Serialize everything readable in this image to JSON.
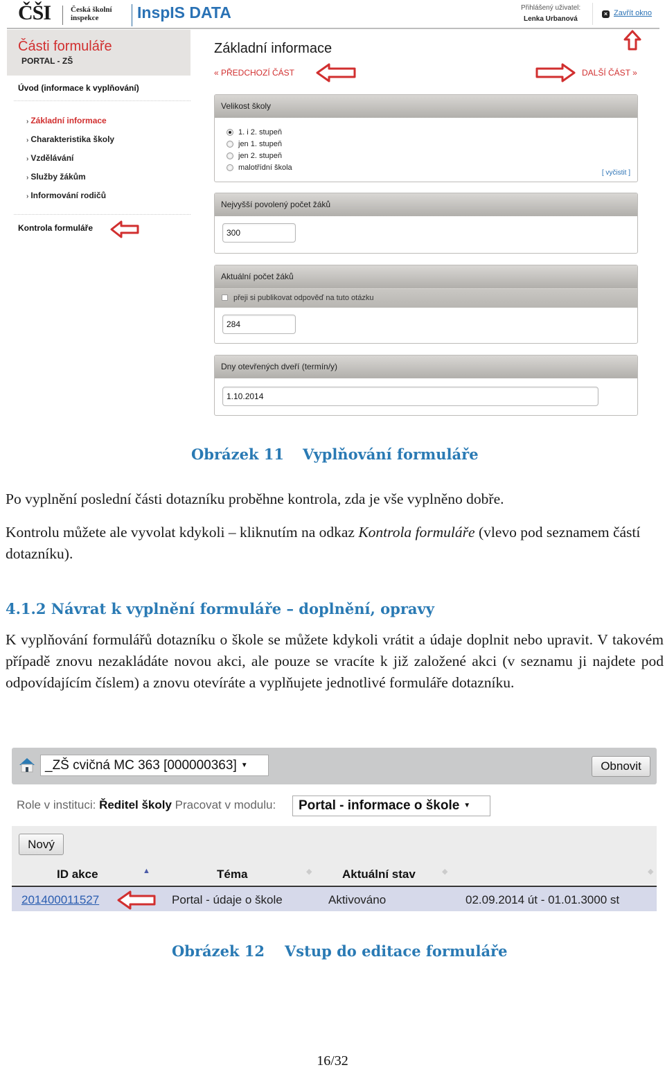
{
  "figure1": {
    "logo": {
      "brand": "ČŠI",
      "org_line1": "Česká školní",
      "org_line2": "inspekce",
      "app": "InspIS DATA"
    },
    "user": {
      "label": "Přihlášený uživatel:",
      "name": "Lenka Urbanová",
      "close_label": "Zavřít okno"
    },
    "sidebar": {
      "title": "Části formuláře",
      "subtitle": "PORTAL - ZŠ",
      "intro": "Úvod (informace k vyplňování)",
      "items": [
        {
          "label": "Základní informace",
          "active": true
        },
        {
          "label": "Charakteristika školy",
          "active": false
        },
        {
          "label": "Vzdělávání",
          "active": false
        },
        {
          "label": "Služby žákům",
          "active": false
        },
        {
          "label": "Informování rodičů",
          "active": false
        }
      ],
      "check_link": "Kontrola formuláře",
      "chevron": "›"
    },
    "main": {
      "title": "Základní informace",
      "prev": "« PŘEDCHOZÍ ČÁST",
      "next": "DALŠÍ ČÁST »",
      "panels": {
        "size": {
          "title": "Velikost školy",
          "options": [
            "1. i 2. stupeň",
            "jen 1. stupeň",
            "jen 2. stupeň",
            "malotřídní škola"
          ],
          "selected": "1. i 2. stupeň",
          "clear": "[ vyčistit ]"
        },
        "max_students": {
          "title": "Nejvyšší povolený počet žáků",
          "value": "300"
        },
        "current_students": {
          "title": "Aktuální počet žáků",
          "publish_label": "přeji si publikovat odpověď na tuto otázku",
          "publish_checked": false,
          "value": "284"
        },
        "open_days": {
          "title": "Dny otevřených dveří (termín/y)",
          "value": "1.10.2014"
        }
      }
    },
    "caption_num": "Obrázek 11",
    "caption_text": "Vyplňování formuláře"
  },
  "text": {
    "p1": "Po vyplnění poslední části dotazníku proběhne kontrola, zda je vše vyplněno dobře.",
    "p2_before": "Kontrolu můžete ale vyvolat kdykoli – kliknutím na odkaz ",
    "p2_italic": "Kontrola formuláře",
    "p2_after": " (vlevo pod seznamem částí dotazníku).",
    "section_heading": "4.1.2  Návrat k vyplnění formuláře – doplnění, opravy",
    "p3": "K vyplňování formulářů dotazníku o škole se můžete kdykoli vrátit a údaje doplnit nebo upravit. V takovém případě znovu nezakládáte novou akci, ale pouze se vracíte k již založené akci (v seznamu ji najdete pod odpovídajícím číslem) a znovu otevíráte a vyplňujete jednotlivé formuláře dotazníku."
  },
  "figure2": {
    "institution": "_ZŠ cvičná MC 363 [000000363]",
    "refresh": "Obnovit",
    "role_label": "Role v instituci:",
    "role_value": "Ředitel školy",
    "module_label": "Pracovat v modulu:",
    "module_value": "Portal - informace o škole",
    "new_button": "Nový",
    "columns": [
      "ID akce",
      "Téma",
      "Aktuální stav",
      ""
    ],
    "rows": [
      {
        "id": "201400011527",
        "topic": "Portal - údaje o škole",
        "status": "Aktivováno",
        "period": "02.09.2014 út - 01.01.3000 st"
      }
    ],
    "caption_num": "Obrázek 12",
    "caption_text": "Vstup do editace formuláře"
  },
  "page": "16/32",
  "colors": {
    "accent_red": "#d12f2f",
    "caption_blue": "#2a7ab4",
    "link_blue": "#2a72b5"
  }
}
